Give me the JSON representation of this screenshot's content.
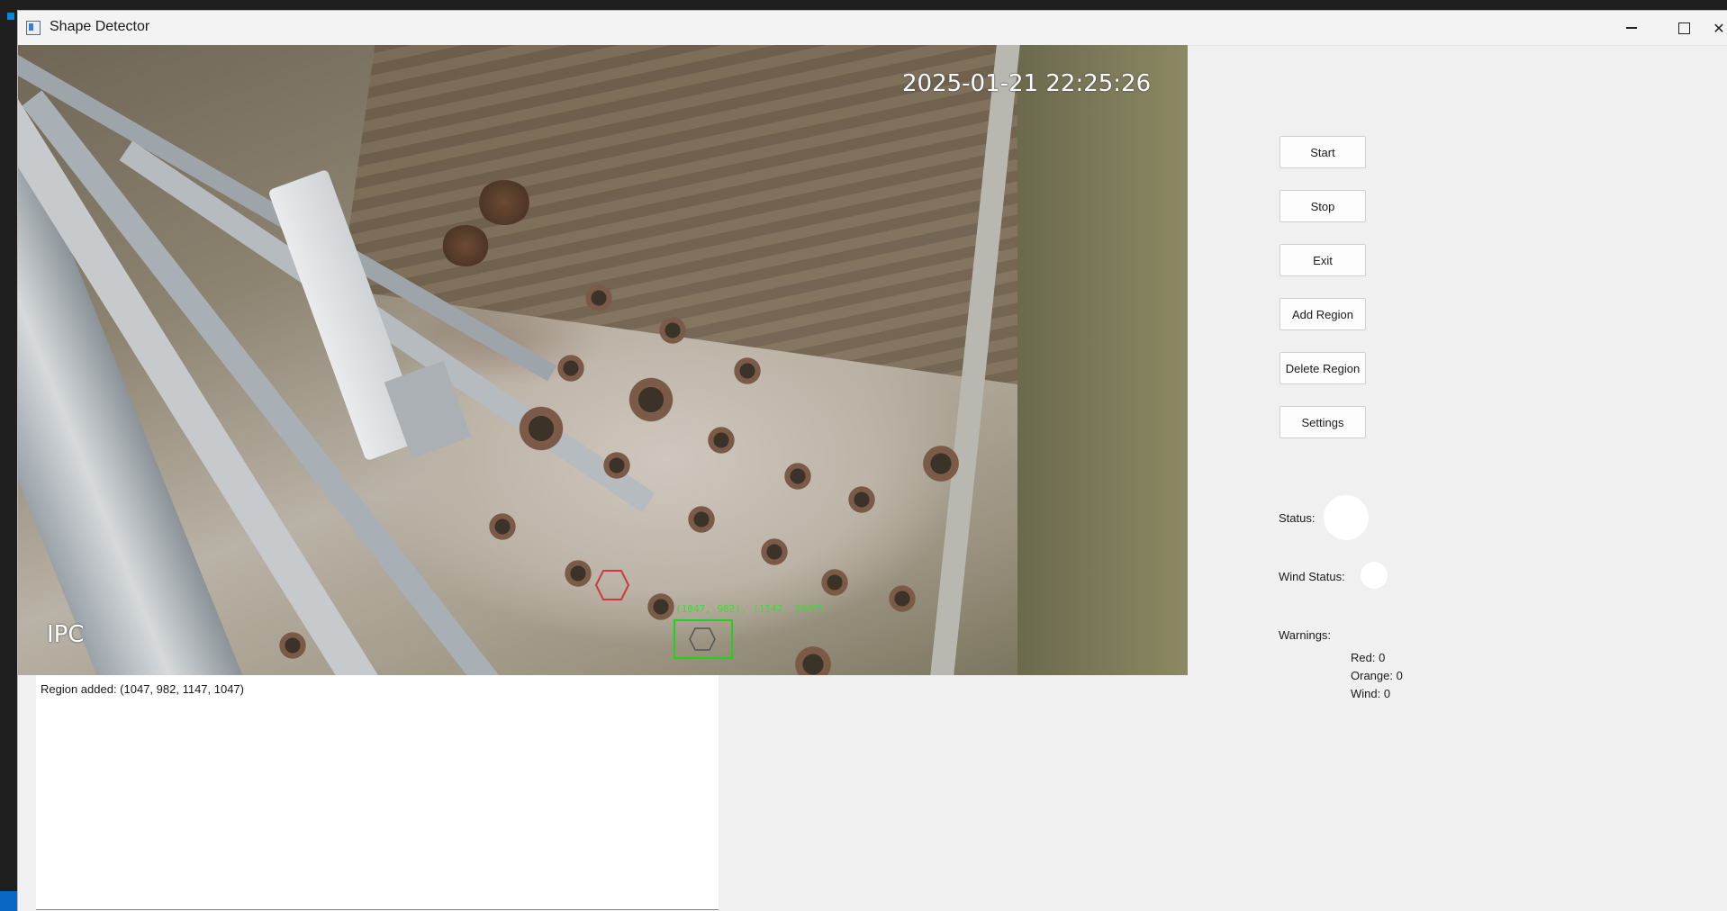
{
  "window": {
    "title": "Shape Detector"
  },
  "video": {
    "timestamp": "2025-01-21 22:25:26",
    "watermark": "IPC",
    "detection_label": "(1047, 982), (1147, 1047)"
  },
  "controls": {
    "start": "Start",
    "stop": "Stop",
    "exit": "Exit",
    "add_region": "Add Region",
    "delete_region": "Delete Region",
    "settings": "Settings"
  },
  "status": {
    "status_label": "Status:",
    "wind_label": "Wind Status:",
    "status_color": "#ffffff",
    "wind_color": "#ffffff"
  },
  "warnings": {
    "title": "Warnings:",
    "red": "Red: 0",
    "orange": "Orange: 0",
    "wind": "Wind: 0"
  },
  "log": {
    "lines": [
      "Region added: (1047, 982, 1147, 1047)"
    ]
  },
  "colors": {
    "detection_box": "#22d11c"
  }
}
